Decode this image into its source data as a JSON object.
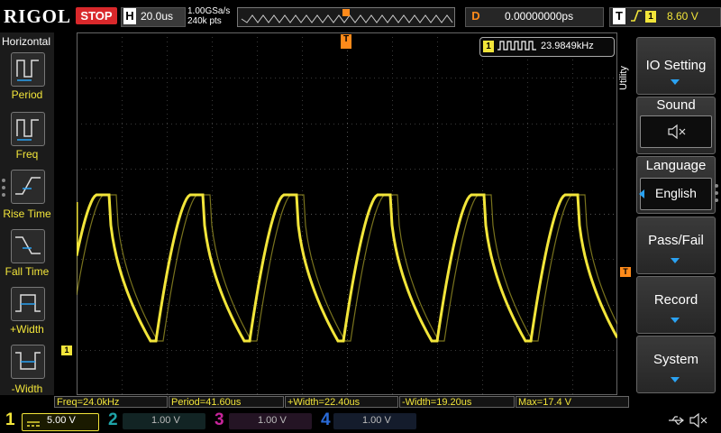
{
  "header": {
    "brand": "RIGOL",
    "run_state": "STOP",
    "horizontal_key": "H",
    "timebase": "20.0us",
    "sample_rate": "1.00GSa/s",
    "memory_depth": "240k pts",
    "delay_key": "D",
    "delay": "0.00000000ps",
    "trigger_key": "T",
    "trigger_source": "1",
    "trigger_level": "8.60 V"
  },
  "left_menu": {
    "title": "Horizontal",
    "items": [
      {
        "label": "Period",
        "icon": "period-icon"
      },
      {
        "label": "Freq",
        "icon": "freq-icon"
      },
      {
        "label": "Rise Time",
        "icon": "rise-time-icon"
      },
      {
        "label": "Fall Time",
        "icon": "fall-time-icon"
      },
      {
        "label": "+Width",
        "icon": "pos-width-icon"
      },
      {
        "label": "-Width",
        "icon": "neg-width-icon"
      }
    ]
  },
  "right_menu": {
    "side_label": "Utility",
    "io_setting": "IO Setting",
    "sound": "Sound",
    "language": "Language",
    "language_value": "English",
    "pass_fail": "Pass/Fail",
    "record": "Record",
    "system": "System"
  },
  "display": {
    "freq_channel": "1",
    "freq_counter": "23.9849kHz",
    "trigger_pos_marker": "T",
    "trigger_level_marker": "T",
    "ch1_ground_marker": "1"
  },
  "measurements": [
    "Freq=24.0kHz",
    "Period=41.60us",
    "+Width=22.40us",
    "-Width=19.20us",
    "Max=17.4 V"
  ],
  "channels": [
    {
      "num": "1",
      "scale": "5.00 V",
      "color": "#f2e53a",
      "active": true
    },
    {
      "num": "2",
      "scale": "1.00 V",
      "color": "#1fa3a8",
      "active": false
    },
    {
      "num": "3",
      "scale": "1.00 V",
      "color": "#c7259b",
      "active": false
    },
    {
      "num": "4",
      "scale": "1.00 V",
      "color": "#2a6bd9",
      "active": false
    }
  ],
  "colors": {
    "ch1": "#f2e53a",
    "stop": "#d9282b",
    "trigger_marker": "#ff8a1a",
    "menu_arrow": "#2aa2f2"
  }
}
